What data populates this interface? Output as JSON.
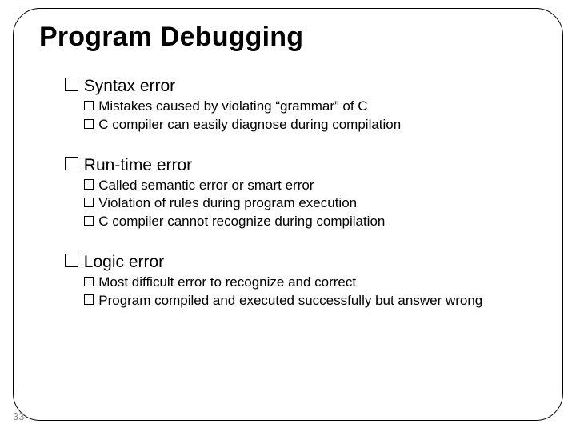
{
  "slide": {
    "title": "Program Debugging",
    "page_number": "33",
    "sections": [
      {
        "heading": "Syntax error",
        "items": [
          "Mistakes caused by violating “grammar” of C",
          "C compiler can easily diagnose during compilation"
        ]
      },
      {
        "heading": "Run-time error",
        "items": [
          "Called semantic error or smart error",
          "Violation of rules during program execution",
          "C compiler cannot recognize during compilation"
        ]
      },
      {
        "heading": "Logic error",
        "items": [
          "Most difficult error to recognize and correct",
          "Program compiled and executed successfully but answer wrong"
        ]
      }
    ]
  }
}
